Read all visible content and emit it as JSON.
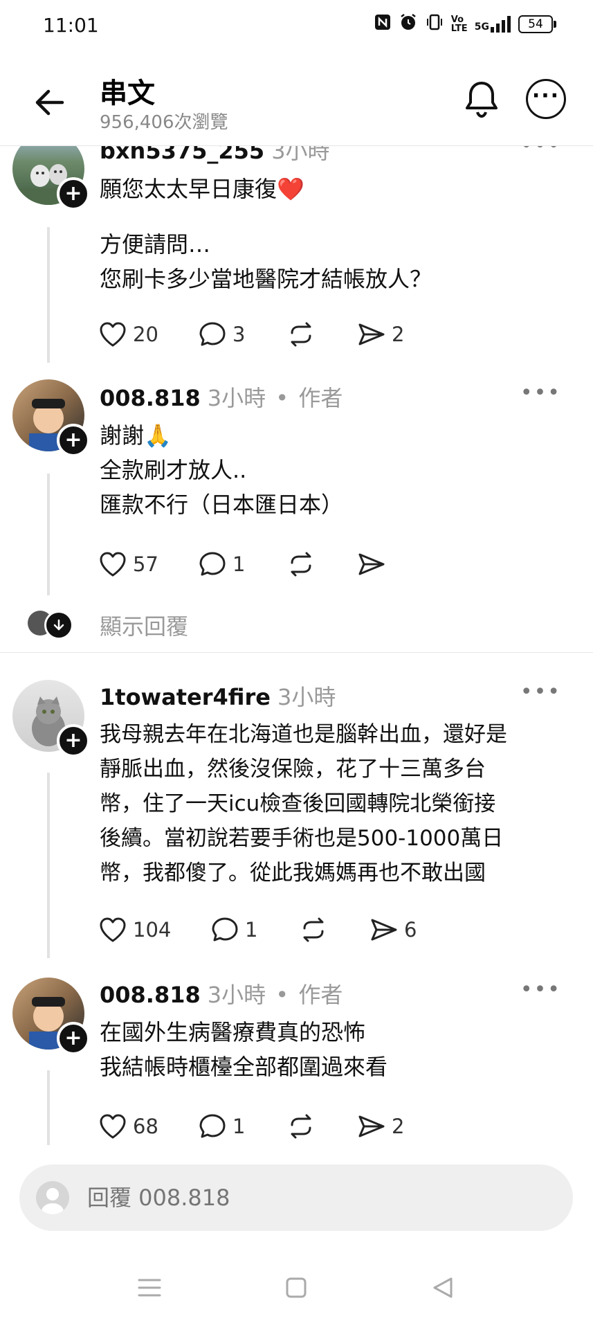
{
  "status_bar": {
    "time": "11:01",
    "icons": [
      "nfc-icon",
      "alarm-icon",
      "vibrate-icon",
      "volte-icon",
      "5g-signal-icon"
    ],
    "volte": "Vo LTE",
    "network": "5G",
    "battery": "54"
  },
  "header": {
    "title": "串文",
    "views": "956,406次瀏覽"
  },
  "posts": [
    {
      "username": "bxh5375_255",
      "time": "3小時",
      "author_tag": "",
      "body": [
        "願您太太早日康復❤️",
        "",
        "方便請問…",
        "您刷卡多少當地醫院才結帳放人？"
      ],
      "likes": "20",
      "comments": "3",
      "shares": "2"
    },
    {
      "username": "008.818",
      "time": "3小時",
      "author_tag": "作者",
      "body": [
        "謝謝🙏",
        "全款刷才放人..",
        "匯款不行（日本匯日本）"
      ],
      "likes": "57",
      "comments": "1",
      "shares": ""
    },
    {
      "username": "1towater4fire",
      "time": "3小時",
      "author_tag": "",
      "body": [
        "我母親去年在北海道也是腦幹出血，還好是",
        "靜脈出血，然後沒保險，花了十三萬多台",
        "幣，住了一天icu檢查後回國轉院北榮銜接",
        "後續。當初說若要手術也是500-1000萬日",
        "幣，我都傻了。從此我媽媽再也不敢出國"
      ],
      "likes": "104",
      "comments": "1",
      "shares": "6"
    },
    {
      "username": "008.818",
      "time": "3小時",
      "author_tag": "作者",
      "body": [
        "在國外生病醫療費真的恐怖",
        "我結帳時櫃檯全部都圍過來看"
      ],
      "likes": "68",
      "comments": "1",
      "shares": "2"
    }
  ],
  "show_replies": "顯示回覆",
  "reply_bar": {
    "placeholder": "回覆 008.818"
  },
  "colors": {
    "heart_red": "#e0242c",
    "muted_text": "#999999",
    "reply_bar_bg": "#efefef"
  }
}
